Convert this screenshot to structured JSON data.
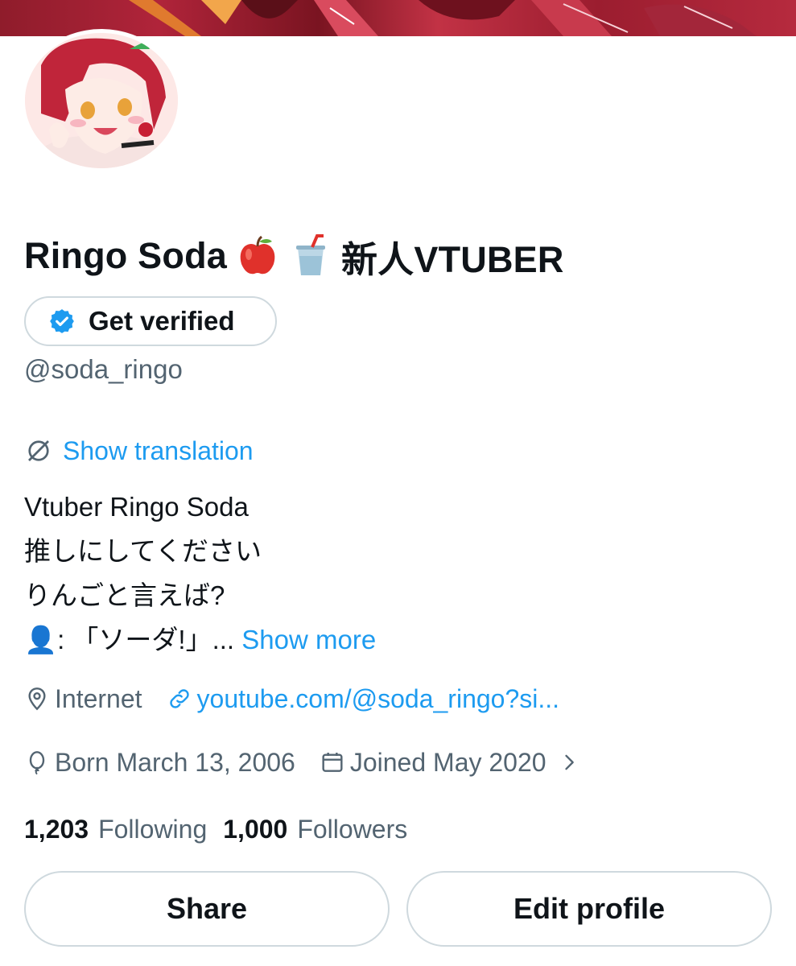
{
  "profile": {
    "display_name": "Ringo Soda",
    "display_name_suffix": "新人VTUBER",
    "name_emojis": [
      "apple-emoji",
      "cup-with-straw-emoji"
    ],
    "handle": "@soda_ringo",
    "verify_label": "Get verified",
    "translate_label": "Show translation",
    "bio_lines": [
      "Vtuber Ringo Soda",
      "推しにしてください",
      "りんごと言えば?",
      "👤: 「ソーダ!」..."
    ],
    "show_more_label": "Show more",
    "location": "Internet",
    "website": "youtube.com/@soda_ringo?si...",
    "birthday": "Born March 13, 2006",
    "joined": "Joined May 2020",
    "following_count": "1,203",
    "following_label": "Following",
    "followers_count": "1,000",
    "followers_label": "Followers",
    "share_label": "Share",
    "edit_label": "Edit profile"
  },
  "colors": {
    "accent": "#1d9bf0",
    "secondary_text": "#536471",
    "border": "#cfd9de",
    "banner": "#9b1d2f"
  },
  "icons": {
    "verified": "verified-badge-icon",
    "translate": "translate-icon",
    "location": "location-pin-icon",
    "link": "link-icon",
    "birthday": "balloon-icon",
    "joined": "calendar-icon",
    "joined_chevron": "chevron-right-icon"
  }
}
